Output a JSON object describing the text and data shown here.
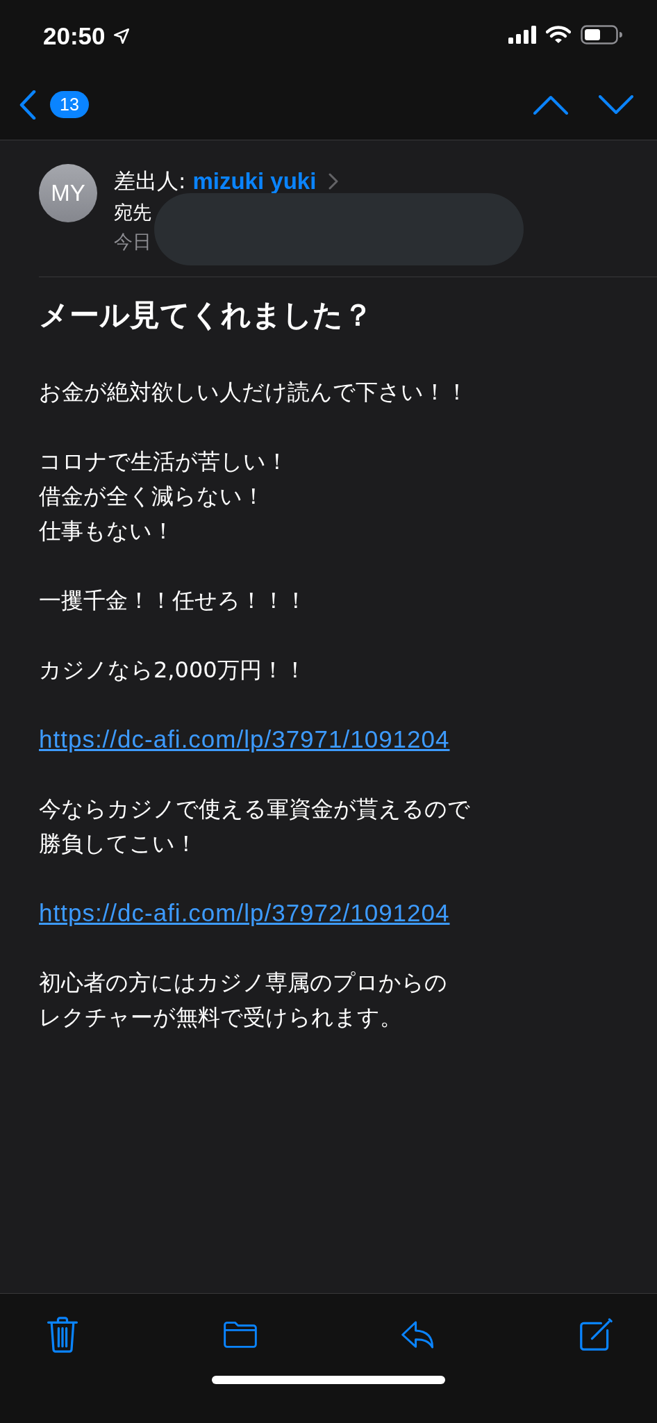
{
  "status_bar": {
    "time": "20:50"
  },
  "nav": {
    "unread_count": "13"
  },
  "header": {
    "avatar_initials": "MY",
    "from_label": "差出人:",
    "sender": "mizuki yuki",
    "to_label": "宛先",
    "date": "今日"
  },
  "subject": "メール見てくれました？",
  "body": [
    {
      "kind": "text",
      "lines": [
        "お金が絶対欲しい人だけ読んで下さい！！"
      ]
    },
    {
      "kind": "text",
      "lines": [
        "コロナで生活が苦しい！",
        "借金が全く減らない！",
        "仕事もない！"
      ]
    },
    {
      "kind": "text",
      "lines": [
        "一攫千金！！任せろ！！！"
      ]
    },
    {
      "kind": "text",
      "lines": [
        "カジノなら2,000万円！！"
      ]
    },
    {
      "kind": "link",
      "lines": [
        "https://dc-afi.com/lp/37971/1091204"
      ]
    },
    {
      "kind": "text",
      "lines": [
        "今ならカジノで使える軍資金が貰えるので",
        "勝負してこい！"
      ]
    },
    {
      "kind": "link",
      "lines": [
        "https://dc-afi.com/lp/37972/1091204"
      ]
    },
    {
      "kind": "text",
      "lines": [
        "初心者の方にはカジノ専属のプロからの",
        "レクチャーが無料で受けられます。"
      ]
    }
  ]
}
